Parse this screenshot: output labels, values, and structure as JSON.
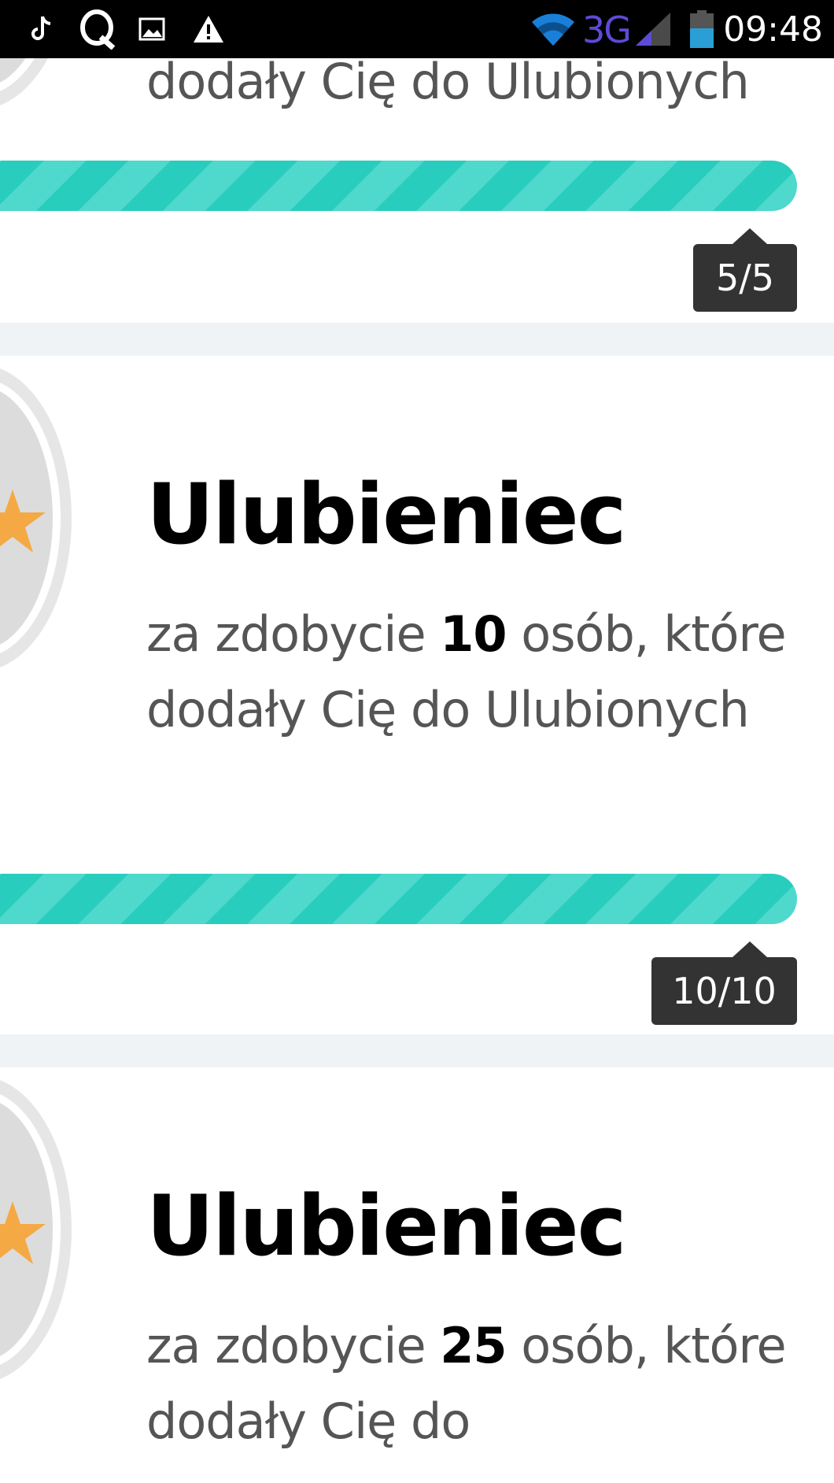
{
  "status_bar": {
    "time": "09:48",
    "network": "3G",
    "icons": [
      "tiktok-icon",
      "q-icon",
      "image-icon",
      "warning-icon",
      "wifi-icon",
      "signal-icon",
      "battery-icon"
    ]
  },
  "achievements": [
    {
      "description_tail": "dodały Cię do Ulubionych",
      "progress": {
        "value": 1.0,
        "label": "5/5"
      }
    },
    {
      "title": "Ulubieniec",
      "description": {
        "prefix": "za zdobycie ",
        "count": "10",
        "suffix": " osób, które dodały Cię do Ulubionych"
      },
      "progress": {
        "value": 1.0,
        "label": "10/10"
      }
    },
    {
      "title": "Ulubieniec",
      "description": {
        "prefix": "za zdobycie ",
        "count": "25",
        "suffix": " osób, które dodały Cię do"
      }
    }
  ],
  "colors": {
    "progress": "#28cfc0",
    "progress_stripe": "#4fd8cc",
    "tooltip": "#333333",
    "separator": "#f0f3f6",
    "star": "#f5a944"
  }
}
